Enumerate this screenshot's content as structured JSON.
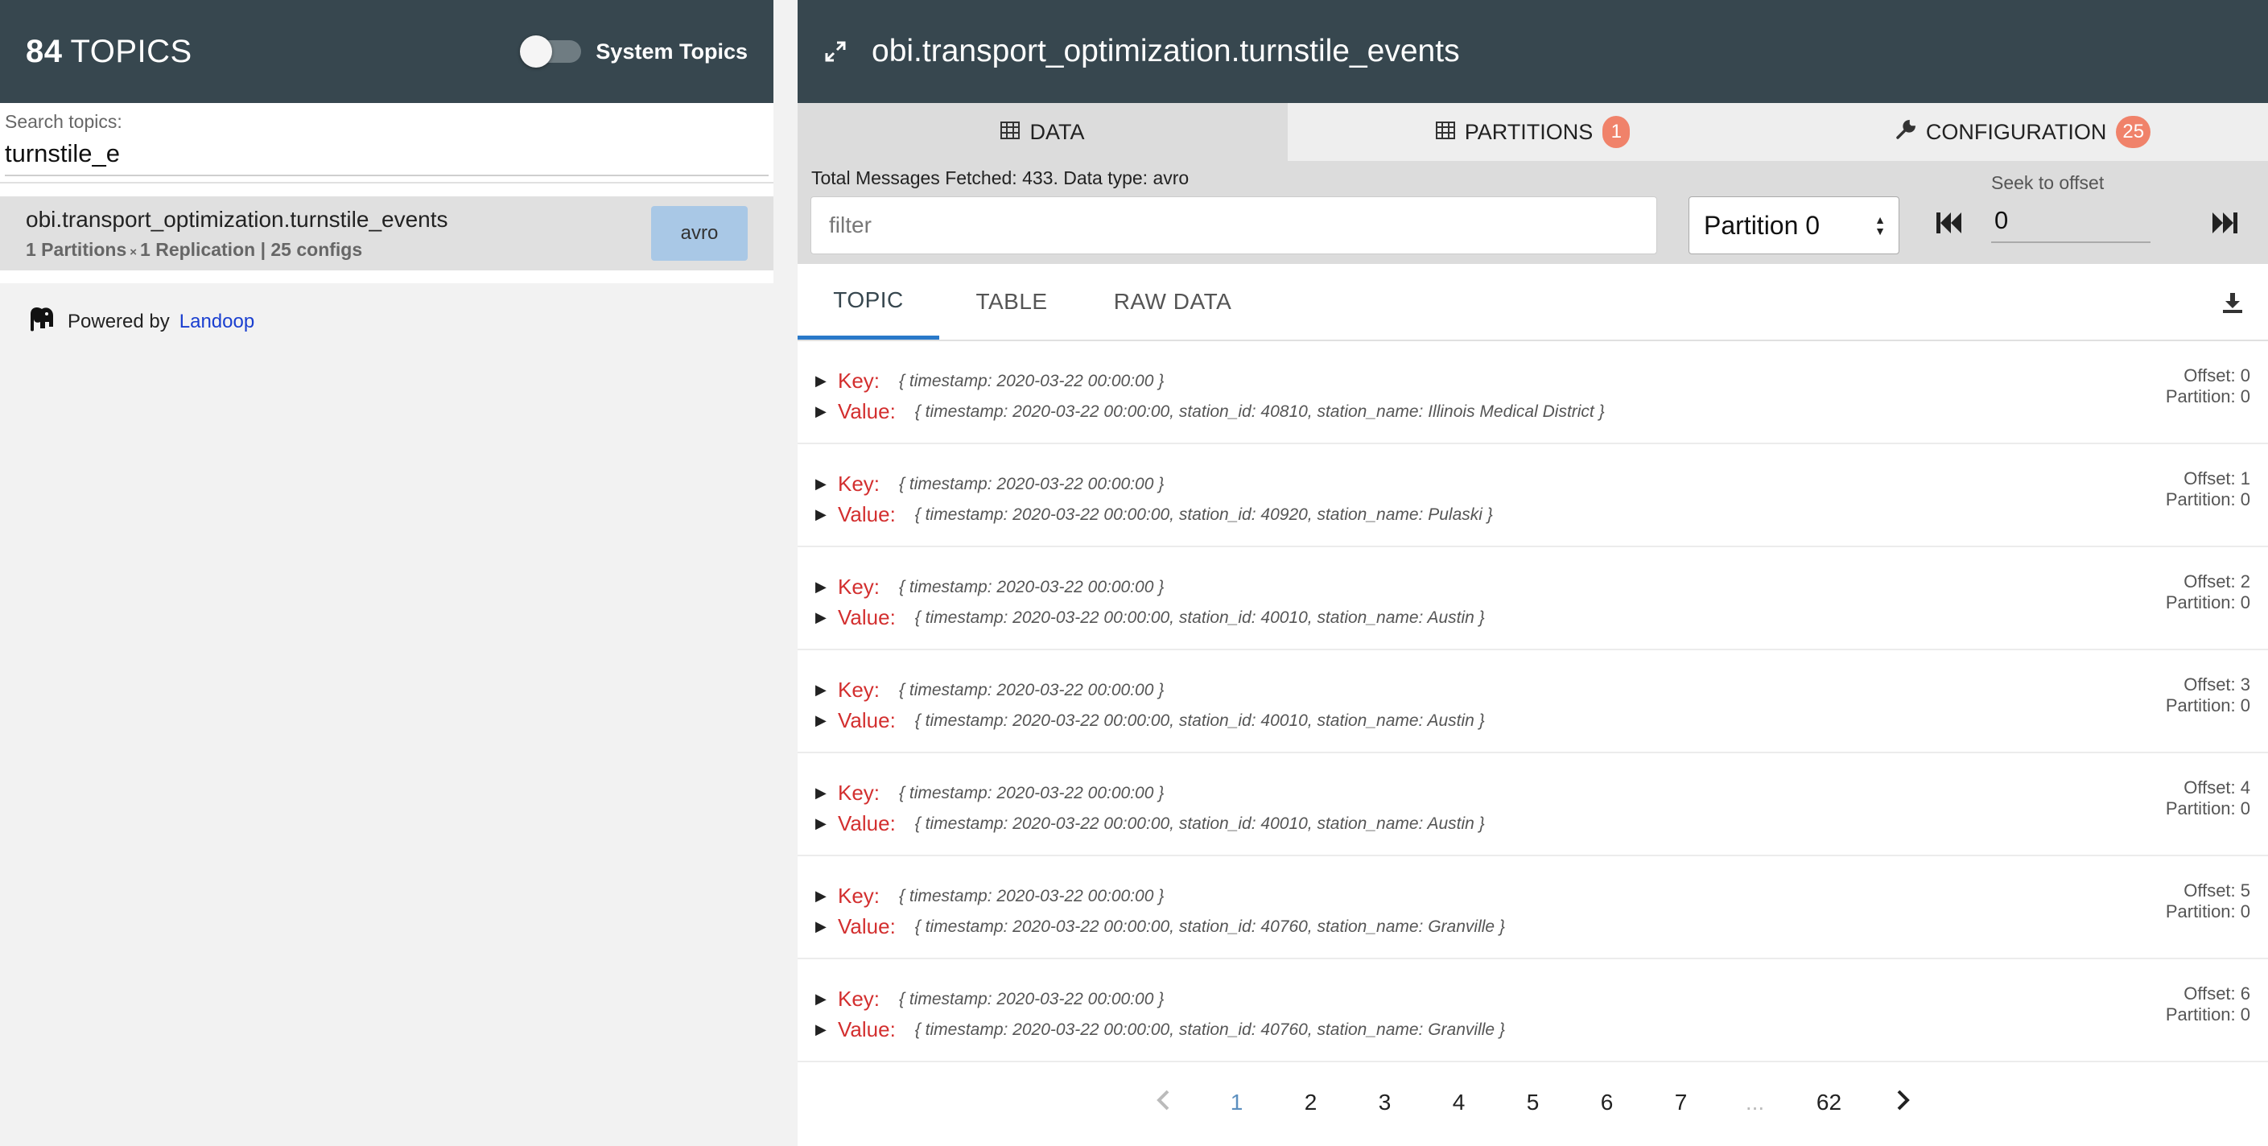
{
  "left": {
    "topics_count": "84",
    "topics_label": "TOPICS",
    "system_topics_label": "System Topics",
    "search_label": "Search topics:",
    "search_value": "turnstile_e",
    "topic": {
      "name": "obi.transport_optimization.turnstile_events",
      "partitions": "1 Partitions",
      "times": "×",
      "replication": "1 Replication | 25 configs",
      "type": "avro"
    },
    "powered_by": "Powered by",
    "powered_link": "Landoop"
  },
  "right": {
    "title": "obi.transport_optimization.turnstile_events",
    "tabs": {
      "data": "DATA",
      "partitions": "PARTITIONS",
      "partitions_badge": "1",
      "configuration": "CONFIGURATION",
      "configuration_badge": "25"
    },
    "fetched": "Total Messages Fetched: 433. Data type: avro",
    "filter_placeholder": "filter",
    "partition_selected": "Partition 0",
    "seek_label": "Seek to offset",
    "seek_value": "0",
    "view_tabs": {
      "topic": "TOPIC",
      "table": "TABLE",
      "raw": "RAW DATA"
    },
    "key_label": "Key:",
    "value_label": "Value:",
    "messages": [
      {
        "key": "{ timestamp: 2020-03-22 00:00:00 }",
        "value": "{ timestamp: 2020-03-22 00:00:00, station_id: 40810, station_name: Illinois Medical District }",
        "offset": "Offset: 0",
        "partition": "Partition: 0"
      },
      {
        "key": "{ timestamp: 2020-03-22 00:00:00 }",
        "value": "{ timestamp: 2020-03-22 00:00:00, station_id: 40920, station_name: Pulaski }",
        "offset": "Offset: 1",
        "partition": "Partition: 0"
      },
      {
        "key": "{ timestamp: 2020-03-22 00:00:00 }",
        "value": "{ timestamp: 2020-03-22 00:00:00, station_id: 40010, station_name: Austin }",
        "offset": "Offset: 2",
        "partition": "Partition: 0"
      },
      {
        "key": "{ timestamp: 2020-03-22 00:00:00 }",
        "value": "{ timestamp: 2020-03-22 00:00:00, station_id: 40010, station_name: Austin }",
        "offset": "Offset: 3",
        "partition": "Partition: 0"
      },
      {
        "key": "{ timestamp: 2020-03-22 00:00:00 }",
        "value": "{ timestamp: 2020-03-22 00:00:00, station_id: 40010, station_name: Austin }",
        "offset": "Offset: 4",
        "partition": "Partition: 0"
      },
      {
        "key": "{ timestamp: 2020-03-22 00:00:00 }",
        "value": "{ timestamp: 2020-03-22 00:00:00, station_id: 40760, station_name: Granville }",
        "offset": "Offset: 5",
        "partition": "Partition: 0"
      },
      {
        "key": "{ timestamp: 2020-03-22 00:00:00 }",
        "value": "{ timestamp: 2020-03-22 00:00:00, station_id: 40760, station_name: Granville }",
        "offset": "Offset: 6",
        "partition": "Partition: 0"
      }
    ],
    "pager": [
      "1",
      "2",
      "3",
      "4",
      "5",
      "6",
      "7",
      "...",
      "62"
    ],
    "colors": {
      "header": "#37474f",
      "accent": "#2979c9",
      "badge": "#f0826a",
      "key_label": "#d32f2f"
    }
  }
}
